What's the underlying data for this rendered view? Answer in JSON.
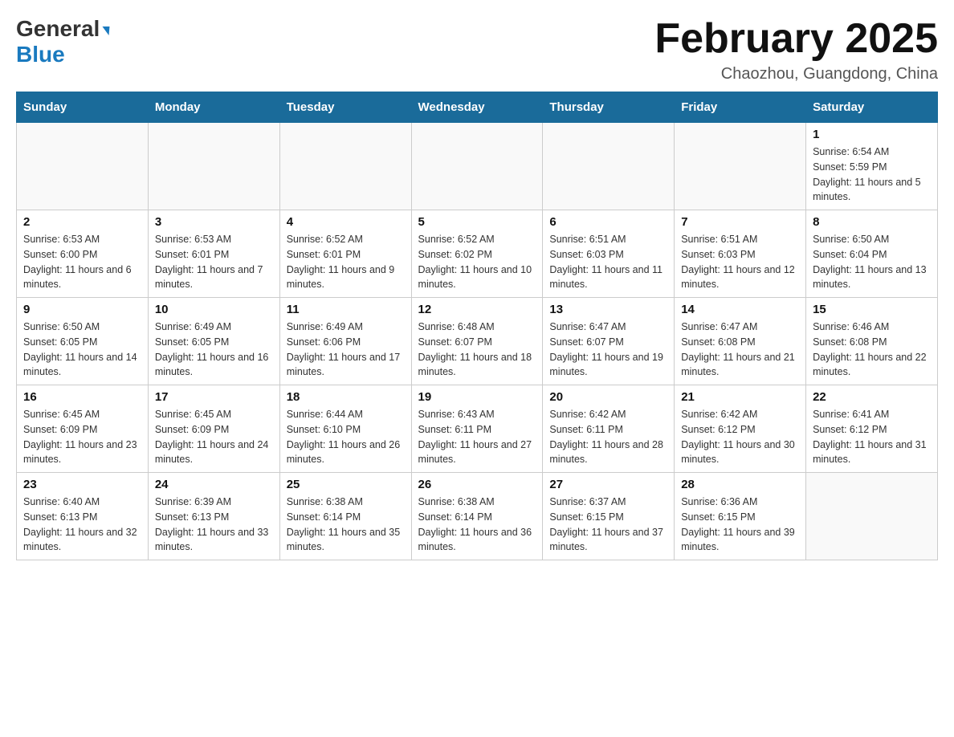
{
  "logo": {
    "general": "General",
    "blue": "Blue",
    "arrow": "▶"
  },
  "title": "February 2025",
  "subtitle": "Chaozhou, Guangdong, China",
  "days_of_week": [
    "Sunday",
    "Monday",
    "Tuesday",
    "Wednesday",
    "Thursday",
    "Friday",
    "Saturday"
  ],
  "weeks": [
    [
      {
        "day": "",
        "info": ""
      },
      {
        "day": "",
        "info": ""
      },
      {
        "day": "",
        "info": ""
      },
      {
        "day": "",
        "info": ""
      },
      {
        "day": "",
        "info": ""
      },
      {
        "day": "",
        "info": ""
      },
      {
        "day": "1",
        "info": "Sunrise: 6:54 AM\nSunset: 5:59 PM\nDaylight: 11 hours and 5 minutes."
      }
    ],
    [
      {
        "day": "2",
        "info": "Sunrise: 6:53 AM\nSunset: 6:00 PM\nDaylight: 11 hours and 6 minutes."
      },
      {
        "day": "3",
        "info": "Sunrise: 6:53 AM\nSunset: 6:01 PM\nDaylight: 11 hours and 7 minutes."
      },
      {
        "day": "4",
        "info": "Sunrise: 6:52 AM\nSunset: 6:01 PM\nDaylight: 11 hours and 9 minutes."
      },
      {
        "day": "5",
        "info": "Sunrise: 6:52 AM\nSunset: 6:02 PM\nDaylight: 11 hours and 10 minutes."
      },
      {
        "day": "6",
        "info": "Sunrise: 6:51 AM\nSunset: 6:03 PM\nDaylight: 11 hours and 11 minutes."
      },
      {
        "day": "7",
        "info": "Sunrise: 6:51 AM\nSunset: 6:03 PM\nDaylight: 11 hours and 12 minutes."
      },
      {
        "day": "8",
        "info": "Sunrise: 6:50 AM\nSunset: 6:04 PM\nDaylight: 11 hours and 13 minutes."
      }
    ],
    [
      {
        "day": "9",
        "info": "Sunrise: 6:50 AM\nSunset: 6:05 PM\nDaylight: 11 hours and 14 minutes."
      },
      {
        "day": "10",
        "info": "Sunrise: 6:49 AM\nSunset: 6:05 PM\nDaylight: 11 hours and 16 minutes."
      },
      {
        "day": "11",
        "info": "Sunrise: 6:49 AM\nSunset: 6:06 PM\nDaylight: 11 hours and 17 minutes."
      },
      {
        "day": "12",
        "info": "Sunrise: 6:48 AM\nSunset: 6:07 PM\nDaylight: 11 hours and 18 minutes."
      },
      {
        "day": "13",
        "info": "Sunrise: 6:47 AM\nSunset: 6:07 PM\nDaylight: 11 hours and 19 minutes."
      },
      {
        "day": "14",
        "info": "Sunrise: 6:47 AM\nSunset: 6:08 PM\nDaylight: 11 hours and 21 minutes."
      },
      {
        "day": "15",
        "info": "Sunrise: 6:46 AM\nSunset: 6:08 PM\nDaylight: 11 hours and 22 minutes."
      }
    ],
    [
      {
        "day": "16",
        "info": "Sunrise: 6:45 AM\nSunset: 6:09 PM\nDaylight: 11 hours and 23 minutes."
      },
      {
        "day": "17",
        "info": "Sunrise: 6:45 AM\nSunset: 6:09 PM\nDaylight: 11 hours and 24 minutes."
      },
      {
        "day": "18",
        "info": "Sunrise: 6:44 AM\nSunset: 6:10 PM\nDaylight: 11 hours and 26 minutes."
      },
      {
        "day": "19",
        "info": "Sunrise: 6:43 AM\nSunset: 6:11 PM\nDaylight: 11 hours and 27 minutes."
      },
      {
        "day": "20",
        "info": "Sunrise: 6:42 AM\nSunset: 6:11 PM\nDaylight: 11 hours and 28 minutes."
      },
      {
        "day": "21",
        "info": "Sunrise: 6:42 AM\nSunset: 6:12 PM\nDaylight: 11 hours and 30 minutes."
      },
      {
        "day": "22",
        "info": "Sunrise: 6:41 AM\nSunset: 6:12 PM\nDaylight: 11 hours and 31 minutes."
      }
    ],
    [
      {
        "day": "23",
        "info": "Sunrise: 6:40 AM\nSunset: 6:13 PM\nDaylight: 11 hours and 32 minutes."
      },
      {
        "day": "24",
        "info": "Sunrise: 6:39 AM\nSunset: 6:13 PM\nDaylight: 11 hours and 33 minutes."
      },
      {
        "day": "25",
        "info": "Sunrise: 6:38 AM\nSunset: 6:14 PM\nDaylight: 11 hours and 35 minutes."
      },
      {
        "day": "26",
        "info": "Sunrise: 6:38 AM\nSunset: 6:14 PM\nDaylight: 11 hours and 36 minutes."
      },
      {
        "day": "27",
        "info": "Sunrise: 6:37 AM\nSunset: 6:15 PM\nDaylight: 11 hours and 37 minutes."
      },
      {
        "day": "28",
        "info": "Sunrise: 6:36 AM\nSunset: 6:15 PM\nDaylight: 11 hours and 39 minutes."
      },
      {
        "day": "",
        "info": ""
      }
    ]
  ]
}
